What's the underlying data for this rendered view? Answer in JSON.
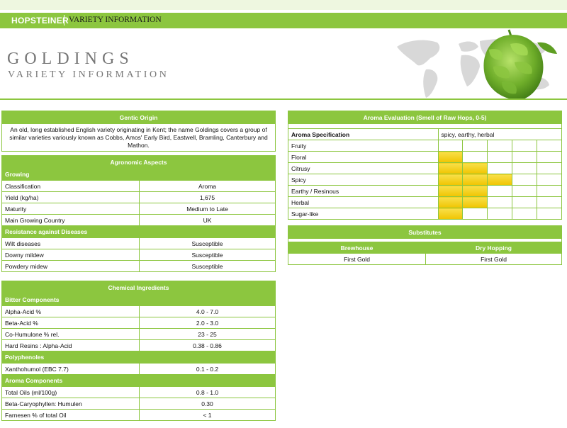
{
  "header": {
    "brand": "HOPSTEINER",
    "section": "VARIETY INFORMATION"
  },
  "title": {
    "variety": "GOLDINGS",
    "subtitle": "VARIETY INFORMATION"
  },
  "genetic_origin": {
    "heading": "Gentic Origin",
    "text": "An old, long established English variety originating in Kent; the name Goldings covers a group of similar varieties variously known as Cobbs, Amos' Early Bird, Eastwell, Bramling, Canterbury and Mathon."
  },
  "agronomic": {
    "heading": "Agronomic Aspects",
    "growing_label": "Growing",
    "growing": [
      {
        "label": "Classification",
        "value": "Aroma"
      },
      {
        "label": "Yield (kg/ha)",
        "value": "1,675"
      },
      {
        "label": "Maturity",
        "value": "Medium to Late"
      },
      {
        "label": "Main Growing Country",
        "value": "UK"
      }
    ],
    "resistance_label": "Resistance against Diseases",
    "resistance": [
      {
        "label": "Wilt diseases",
        "value": "Susceptible"
      },
      {
        "label": "Downy mildew",
        "value": "Susceptible"
      },
      {
        "label": "Powdery midew",
        "value": "Susceptible"
      }
    ]
  },
  "chemical": {
    "heading": "Chemical Ingredients",
    "bitter_label": "Bitter Components",
    "bitter": [
      {
        "label": "Alpha-Acid %",
        "value": "4.0 - 7.0"
      },
      {
        "label": "Beta-Acid %",
        "value": "2.0 - 3.0"
      },
      {
        "label": "Co-Humulone % rel.",
        "value": "23 - 25"
      },
      {
        "label": "Hard Resins : Alpha-Acid",
        "value": "0.38 - 0.86"
      }
    ],
    "poly_label": "Polyphenoles",
    "poly": [
      {
        "label": "Xanthohumol (EBC 7.7)",
        "value": "0.1 - 0.2"
      }
    ],
    "aroma_label": "Aroma Components",
    "aroma": [
      {
        "label": "Total Oils (ml/100g)",
        "value": "0.8 - 1.0"
      },
      {
        "label": "Beta-Caryophyllen: Humulen",
        "value": "0.30"
      },
      {
        "label": "Farnesen % of total Oil",
        "value": "< 1"
      }
    ]
  },
  "aroma_eval": {
    "heading": "Aroma Evaluation (Smell of Raw Hops, 0-5)",
    "spec_label": "Aroma Specification",
    "spec_value": "spicy, earthy, herbal",
    "bar_color": "#f5d000",
    "attributes": [
      {
        "label": "Fruity",
        "score": 0
      },
      {
        "label": "Floral",
        "score": 1
      },
      {
        "label": "Citrusy",
        "score": 2
      },
      {
        "label": "Spicy",
        "score": 3
      },
      {
        "label": "Earthy / Resinous",
        "score": 2
      },
      {
        "label": "Herbal",
        "score": 2
      },
      {
        "label": "Sugar-like",
        "score": 1
      }
    ]
  },
  "substitutes": {
    "heading": "Substitutes",
    "brewhouse_label": "Brewhouse",
    "dryhop_label": "Dry Hopping",
    "brewhouse_value": "First Gold",
    "dryhop_value": "First Gold"
  }
}
